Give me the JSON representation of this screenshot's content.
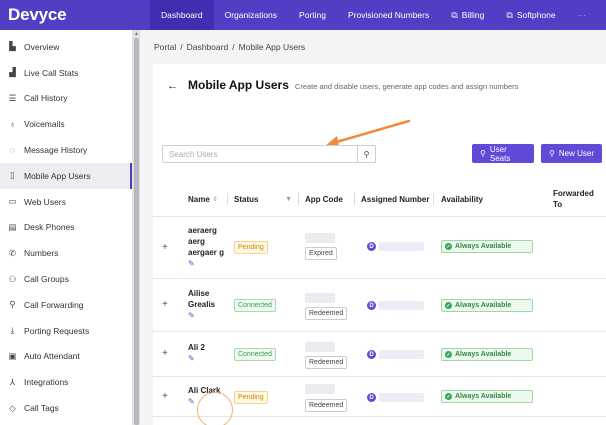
{
  "brand": "Devyce",
  "topnav": [
    {
      "label": "Dashboard",
      "active": true,
      "icon": ""
    },
    {
      "label": "Organizations",
      "active": false,
      "icon": ""
    },
    {
      "label": "Porting",
      "active": false,
      "icon": ""
    },
    {
      "label": "Provisioned Numbers",
      "active": false,
      "icon": ""
    },
    {
      "label": "Billing",
      "active": false,
      "icon": "external-link-icon"
    },
    {
      "label": "Softphone",
      "active": false,
      "icon": "external-link-icon"
    },
    {
      "label": "···",
      "active": false,
      "icon": ""
    }
  ],
  "sidebar": {
    "items": [
      {
        "label": "Overview",
        "icon": "bar-chart-icon"
      },
      {
        "label": "Live Call Stats",
        "icon": "live-chart-icon"
      },
      {
        "label": "Call History",
        "icon": "list-icon"
      },
      {
        "label": "Voicemails",
        "icon": "microphone-icon"
      },
      {
        "label": "Message History",
        "icon": "message-icon"
      },
      {
        "label": "Mobile App Users",
        "icon": "mobile-icon",
        "active": true
      },
      {
        "label": "Web Users",
        "icon": "monitor-icon"
      },
      {
        "label": "Desk Phones",
        "icon": "desk-phone-icon"
      },
      {
        "label": "Numbers",
        "icon": "phone-icon"
      },
      {
        "label": "Call Groups",
        "icon": "users-icon"
      },
      {
        "label": "Call Forwarding",
        "icon": "user-forward-icon"
      },
      {
        "label": "Porting Requests",
        "icon": "download-icon"
      },
      {
        "label": "Auto Attendant",
        "icon": "calculator-icon"
      },
      {
        "label": "Integrations",
        "icon": "integration-icon"
      },
      {
        "label": "Call Tags",
        "icon": "tag-icon"
      }
    ]
  },
  "breadcrumb": [
    "Portal",
    "Dashboard",
    "Mobile App Users"
  ],
  "page": {
    "title": "Mobile App Users",
    "subtitle": "Create and disable users, generate app codes and assign numbers"
  },
  "search": {
    "placeholder": "Search Users",
    "value": ""
  },
  "buttons": {
    "user_seats": "User Seats",
    "new_user": "New User"
  },
  "table": {
    "headers": {
      "name": "Name",
      "status": "Status",
      "app_code": "App Code",
      "assigned_number": "Assigned Number",
      "availability": "Availability",
      "forwarded_to": "Forwarded To"
    },
    "rows": [
      {
        "name": "aeraerg aerg aergaer g",
        "status": "Pending",
        "app_code_tag": "Expired",
        "number_badge": "D",
        "availability": "Always Available"
      },
      {
        "name": "Ailise Grealis",
        "status": "Connected",
        "app_code_tag": "Redeemed",
        "number_badge": "D",
        "availability": "Always Available"
      },
      {
        "name": "Ali 2",
        "status": "Connected",
        "app_code_tag": "Redeemed",
        "number_badge": "D",
        "availability": "Always Available"
      },
      {
        "name": "Ali Clark",
        "status": "Pending",
        "app_code_tag": "Redeemed",
        "number_badge": "D",
        "availability": "Always Available"
      }
    ]
  },
  "colors": {
    "brand": "#4f3fc4",
    "accent": "#5f4bd8",
    "annotation_arrow": "#f08a3c"
  }
}
